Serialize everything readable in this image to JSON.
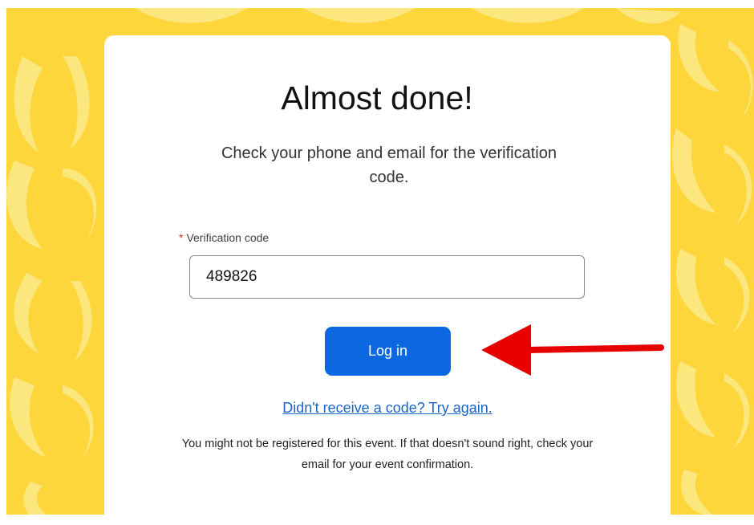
{
  "page": {
    "title": "Almost done!",
    "subtitle": "Check your phone and email for the verification code.",
    "field_label": "Verification code",
    "required_marker": "*",
    "code_value": "489826",
    "login_label": "Log in",
    "retry_link": "Didn't receive a code? Try again.",
    "note": "You might not be registered for this event. If that doesn't sound right, check your email for your event confirmation."
  },
  "colors": {
    "background": "#fcd63a",
    "pattern": "#fde98a",
    "primary_button": "#0b68e0",
    "link": "#1a65c7",
    "annotation_arrow": "#e60000"
  },
  "icons": {
    "annotation": "red-arrow-icon"
  }
}
